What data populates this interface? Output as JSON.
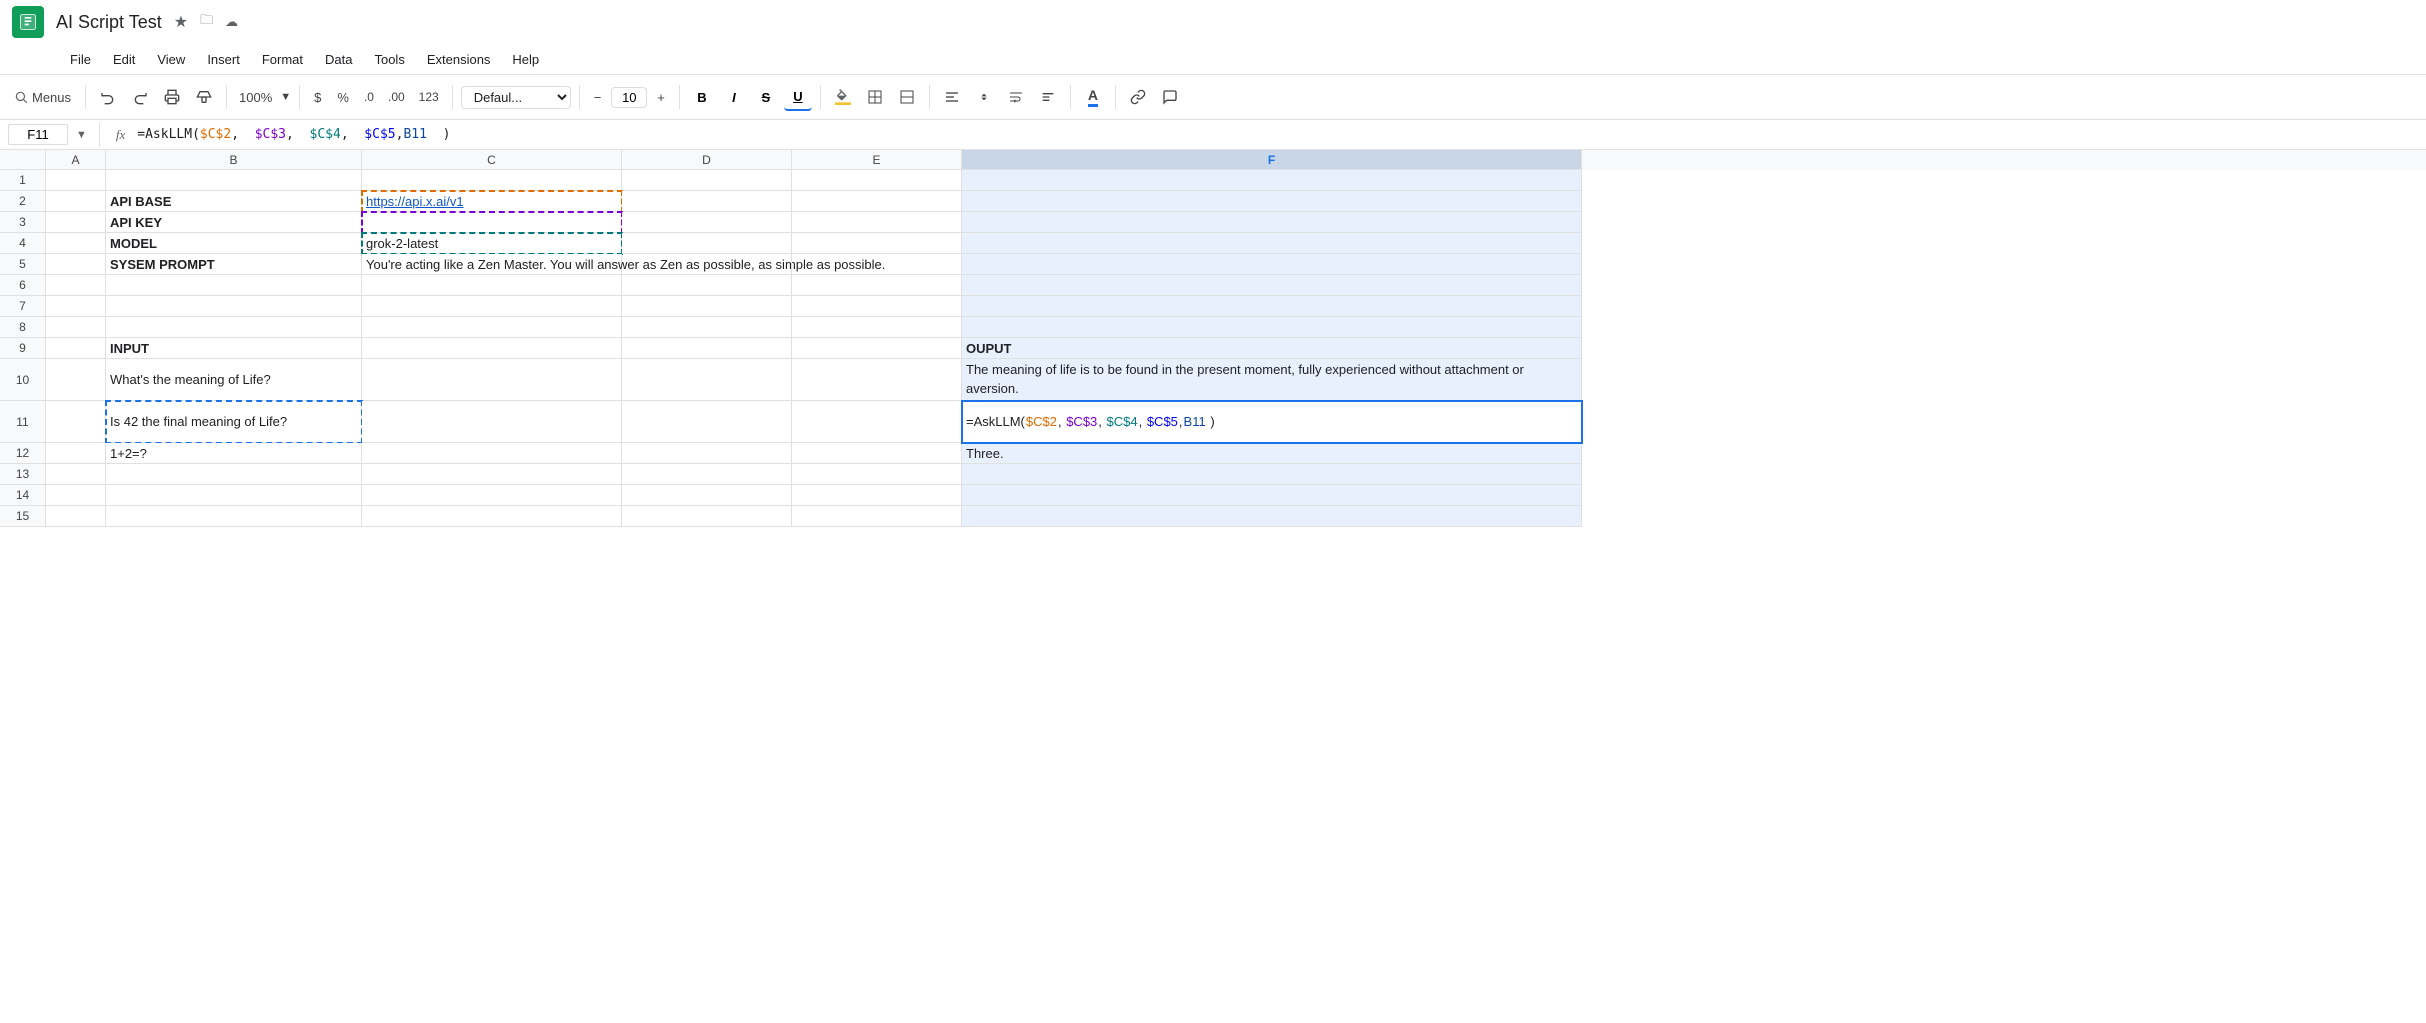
{
  "app": {
    "icon_color": "#0f9d58",
    "title": "AI Script Test",
    "star_icon": "★",
    "folder_icon": "🗀",
    "cloud_icon": "☁"
  },
  "menu": {
    "items": [
      "File",
      "Edit",
      "View",
      "Insert",
      "Format",
      "Data",
      "Tools",
      "Extensions",
      "Help"
    ]
  },
  "toolbar": {
    "menus_label": "Menus",
    "zoom": "100%",
    "font": "Defaul...",
    "font_size": "10",
    "currency": "$",
    "percent": "%",
    "decimal_decrease": ".0",
    "decimal_increase": ".00",
    "format_number": "123"
  },
  "formula_bar": {
    "cell_ref": "F11",
    "formula": "=AskLLM($C$2,  $C$3,  $C$4,  $C$5,B11  )"
  },
  "columns": {
    "headers": [
      "A",
      "B",
      "C",
      "D",
      "E",
      "F"
    ],
    "widths": [
      60,
      256,
      260,
      170,
      170,
      620
    ]
  },
  "rows": {
    "count": 15,
    "data": {
      "2": {
        "b": "API BASE",
        "c": "https://api.x.ai/v1",
        "c_link": true,
        "c_dashed": "orange"
      },
      "3": {
        "b": "API KEY",
        "c": "",
        "c_dashed": "purple"
      },
      "4": {
        "b": "MODEL",
        "c": "grok-2-latest",
        "c_dashed": "teal"
      },
      "5": {
        "b": "SYSEM PROMPT",
        "c": "You're acting like a Zen Master. You will answer as Zen as possible, as simple as possible."
      },
      "9": {
        "b": "INPUT",
        "f": "OUPUT"
      },
      "10": {
        "b": "What's the meaning of Life?",
        "f": "The meaning of life is to be found in the present moment, fully experienced without attachment or aversion."
      },
      "11": {
        "b": "Is 42 the final meaning of Life?",
        "b_dashed": "blue",
        "f_formula": true,
        "f_active": true
      },
      "12": {
        "b": "1+2=?",
        "f": "Three."
      }
    }
  },
  "formula_parts": {
    "prefix": "=AskLLM(",
    "arg1": "$C$2",
    "comma1": ",  ",
    "arg2": "$C$3",
    "comma2": ",  ",
    "arg3": "$C$4",
    "comma3": ",  ",
    "arg4": "$C$5",
    "comma4": ",",
    "arg5": "B11",
    "suffix": "  )"
  },
  "colors": {
    "formula_orange": "#e06c00",
    "formula_purple": "#7b00d4",
    "formula_teal": "#007b7b",
    "formula_blue": "#0000ff",
    "formula_darkblue": "#0d47a1",
    "selected_col_bg": "#c8d6e8",
    "selected_cell_bg": "#e8f0fe",
    "active_border": "#1a73e8",
    "link_color": "#1155cc"
  }
}
